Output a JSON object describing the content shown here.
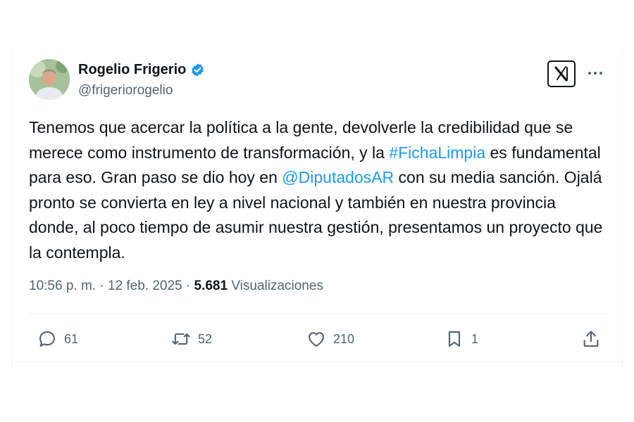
{
  "author": {
    "name": "Rogelio Frigerio",
    "handle": "@frigeriorogelio"
  },
  "tweet": {
    "text_1": "Tenemos que acercar la política a la gente, devolverle la credibilidad que se merece como instrumento de transformación, y la ",
    "hashtag": "#FichaLimpia",
    "text_2": " es fundamental para eso. Gran paso se dio hoy en ",
    "mention": "@DiputadosAR",
    "text_3": " con su media sanción. Ojalá pronto se convierta en ley a nivel nacional y también en nuestra provincia donde, al poco tiempo de asumir nuestra gestión, presentamos un proyecto que la contempla."
  },
  "meta": {
    "time": "10:56 p. m.",
    "separator": " · ",
    "date": "12 feb. 2025",
    "views_count": "5.681",
    "views_label": "Visualizaciones"
  },
  "actions": {
    "replies": "61",
    "reposts": "52",
    "likes": "210",
    "bookmarks": "1"
  },
  "colors": {
    "link": "#1d9bf0",
    "text": "#0f1419",
    "muted": "#536471",
    "verified": "#1d9bf0"
  },
  "icons": [
    "x-logo-icon",
    "more-icon",
    "verified-badge-icon",
    "reply-icon",
    "repost-icon",
    "like-icon",
    "bookmark-icon",
    "share-icon"
  ]
}
